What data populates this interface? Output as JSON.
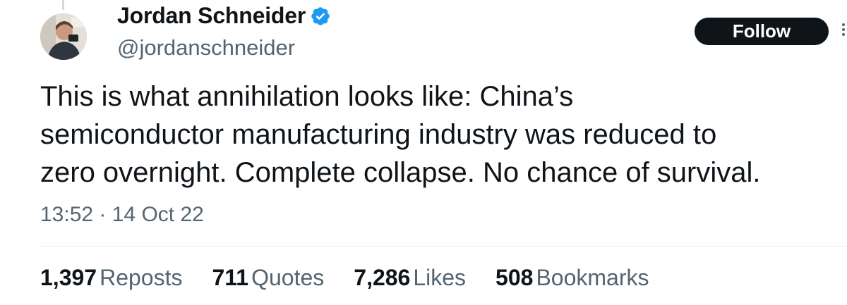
{
  "tweet": {
    "author": {
      "name": "Jordan Schneider",
      "handle": "@jordanschneider",
      "verified": true
    },
    "follow_label": "Follow",
    "text_lines": [
      "This is what annihilation looks like: China’s",
      "semiconductor manufacturing industry was reduced to",
      "zero overnight. Complete collapse. No chance of survival."
    ],
    "timestamp": "13:52 · 14 Oct 22"
  },
  "stats": [
    {
      "value": "1,397",
      "label": "Reposts"
    },
    {
      "value": "711",
      "label": "Quotes"
    },
    {
      "value": "7,286",
      "label": "Likes"
    },
    {
      "value": "508",
      "label": "Bookmarks"
    }
  ],
  "colors": {
    "verified_badge": "#1d9bf0",
    "follow_button_bg": "#0f1419",
    "secondary_text": "#536471"
  }
}
